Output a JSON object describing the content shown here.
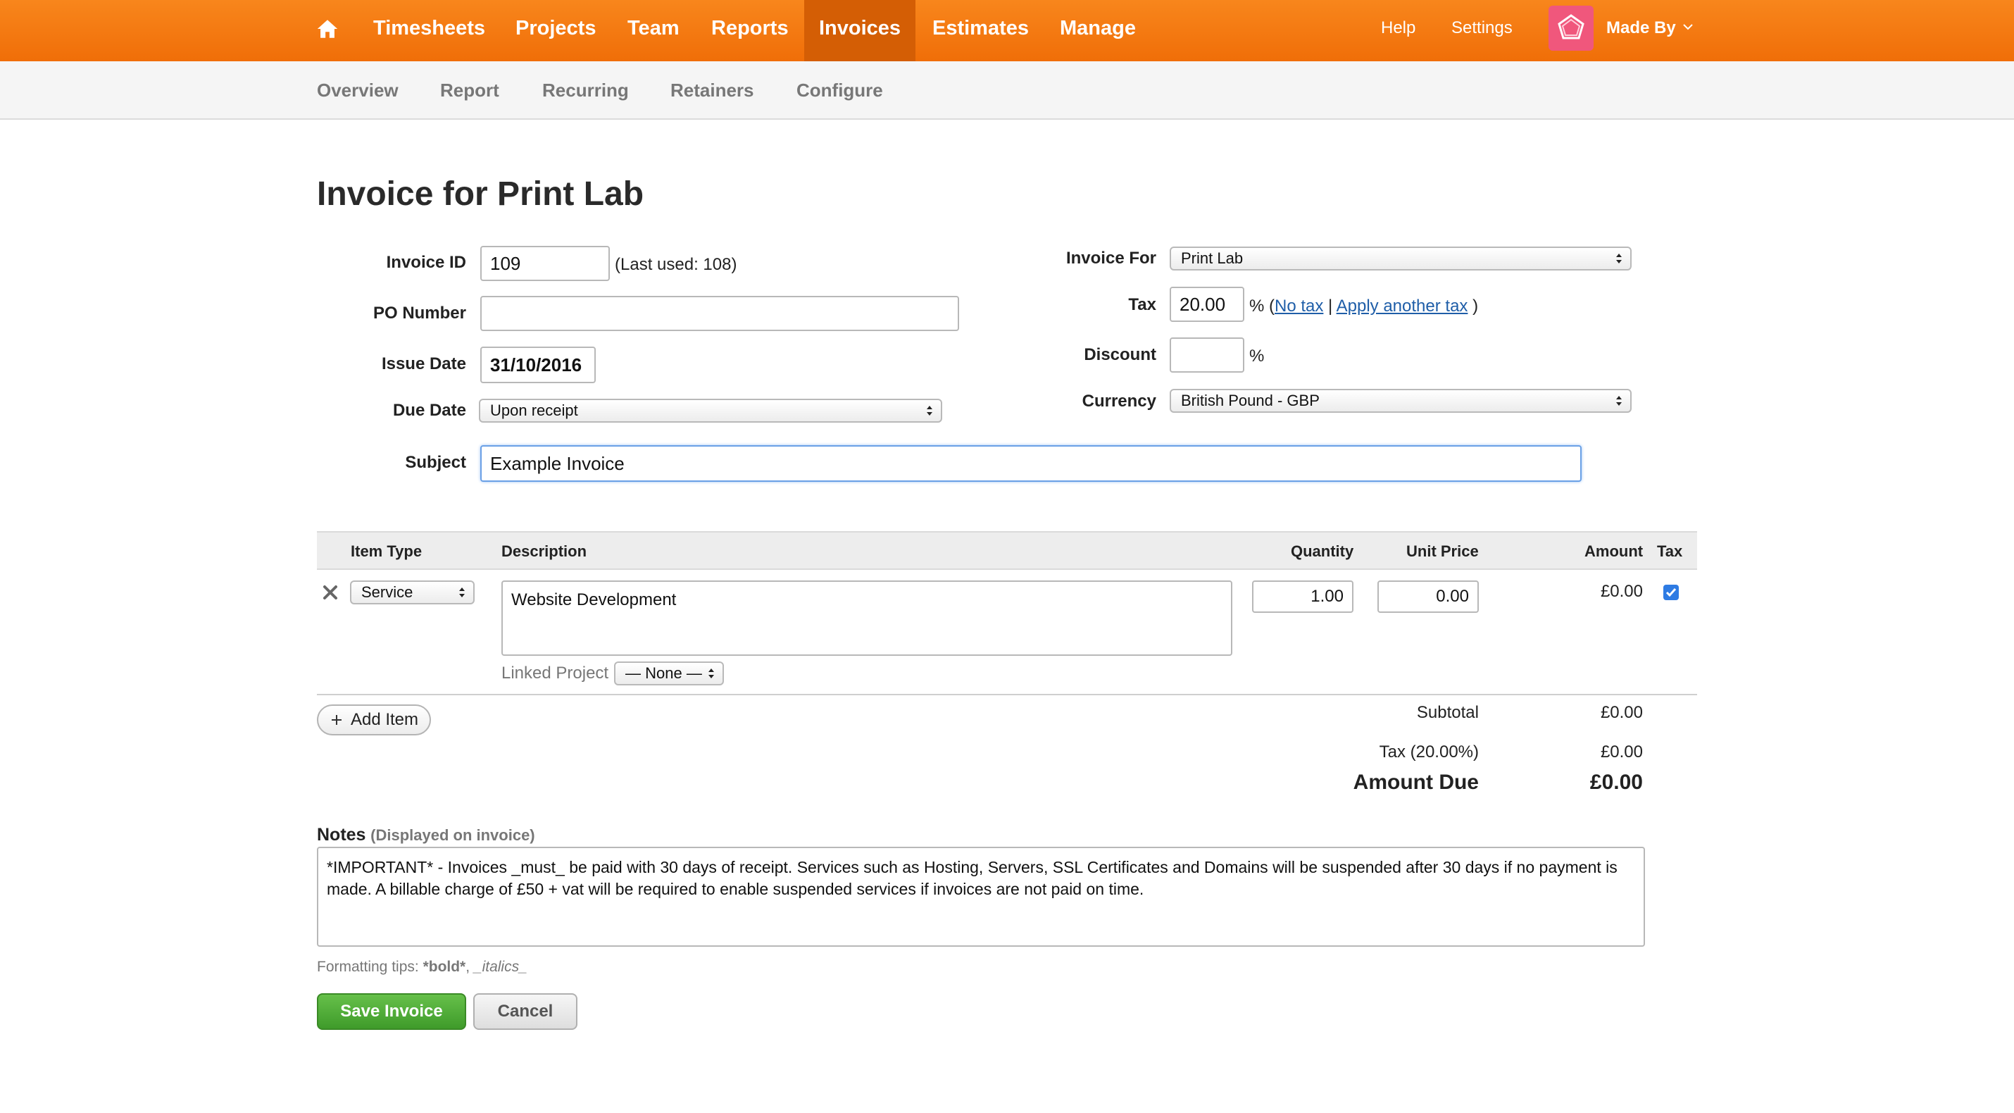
{
  "topnav": {
    "items": [
      {
        "label": "Timesheets"
      },
      {
        "label": "Projects"
      },
      {
        "label": "Team"
      },
      {
        "label": "Reports"
      },
      {
        "label": "Invoices",
        "active": true
      },
      {
        "label": "Estimates"
      },
      {
        "label": "Manage"
      }
    ],
    "help": "Help",
    "settings": "Settings",
    "account": "Made By",
    "colors": {
      "bar": "#f27a12",
      "active": "#d45e05",
      "avatar": "#f0577c"
    }
  },
  "subnav": {
    "items": [
      "Overview",
      "Report",
      "Recurring",
      "Retainers",
      "Configure"
    ]
  },
  "page": {
    "title": "Invoice for Print Lab"
  },
  "form": {
    "invoice_id_label": "Invoice ID",
    "invoice_id_value": "109",
    "last_used": "(Last used: 108)",
    "po_number_label": "PO Number",
    "po_number_value": "",
    "issue_date_label": "Issue Date",
    "issue_date_value": "31/10/2016",
    "due_date_label": "Due Date",
    "due_date_value": "Upon receipt",
    "subject_label": "Subject",
    "subject_value": "Example Invoice",
    "invoice_for_label": "Invoice For",
    "invoice_for_value": "Print Lab",
    "tax_label": "Tax",
    "tax_value": "20.00",
    "tax_pct": "% (",
    "no_tax": "No tax",
    "separator": "|",
    "apply_another_tax": "Apply another tax",
    "close_paren": ")",
    "discount_label": "Discount",
    "discount_value": "",
    "discount_pct": "%",
    "currency_label": "Currency",
    "currency_value": "British Pound - GBP"
  },
  "table": {
    "headers": {
      "item_type": "Item Type",
      "description": "Description",
      "quantity": "Quantity",
      "unit_price": "Unit Price",
      "amount": "Amount",
      "tax": "Tax"
    },
    "rows": [
      {
        "item_type": "Service",
        "description": "Website Development",
        "quantity": "1.00",
        "unit_price": "0.00",
        "amount": "£0.00",
        "tax_checked": true,
        "linked_project_label": "Linked Project",
        "linked_project_value": "— None —"
      }
    ]
  },
  "add_item": "Add Item",
  "totals": {
    "subtotal_label": "Subtotal",
    "subtotal_value": "£0.00",
    "tax_label": "Tax (20.00%)",
    "tax_value": "£0.00",
    "amount_due_label": "Amount Due",
    "amount_due_value": "£0.00"
  },
  "notes": {
    "label": "Notes",
    "hint": "(Displayed on invoice)",
    "value": "*IMPORTANT* - Invoices _must_ be paid with 30 days of receipt. Services such as Hosting, Servers, SSL Certificates and Domains will be suspended after 30 days if no payment is made. A billable charge of £50 + vat will be required to enable suspended services if invoices are not paid on time.",
    "tips_prefix": "Formatting tips: ",
    "tips_bold": "*bold*",
    "tips_sep": ", ",
    "tips_italic": "_italics_"
  },
  "actions": {
    "save": "Save Invoice",
    "cancel": "Cancel"
  }
}
